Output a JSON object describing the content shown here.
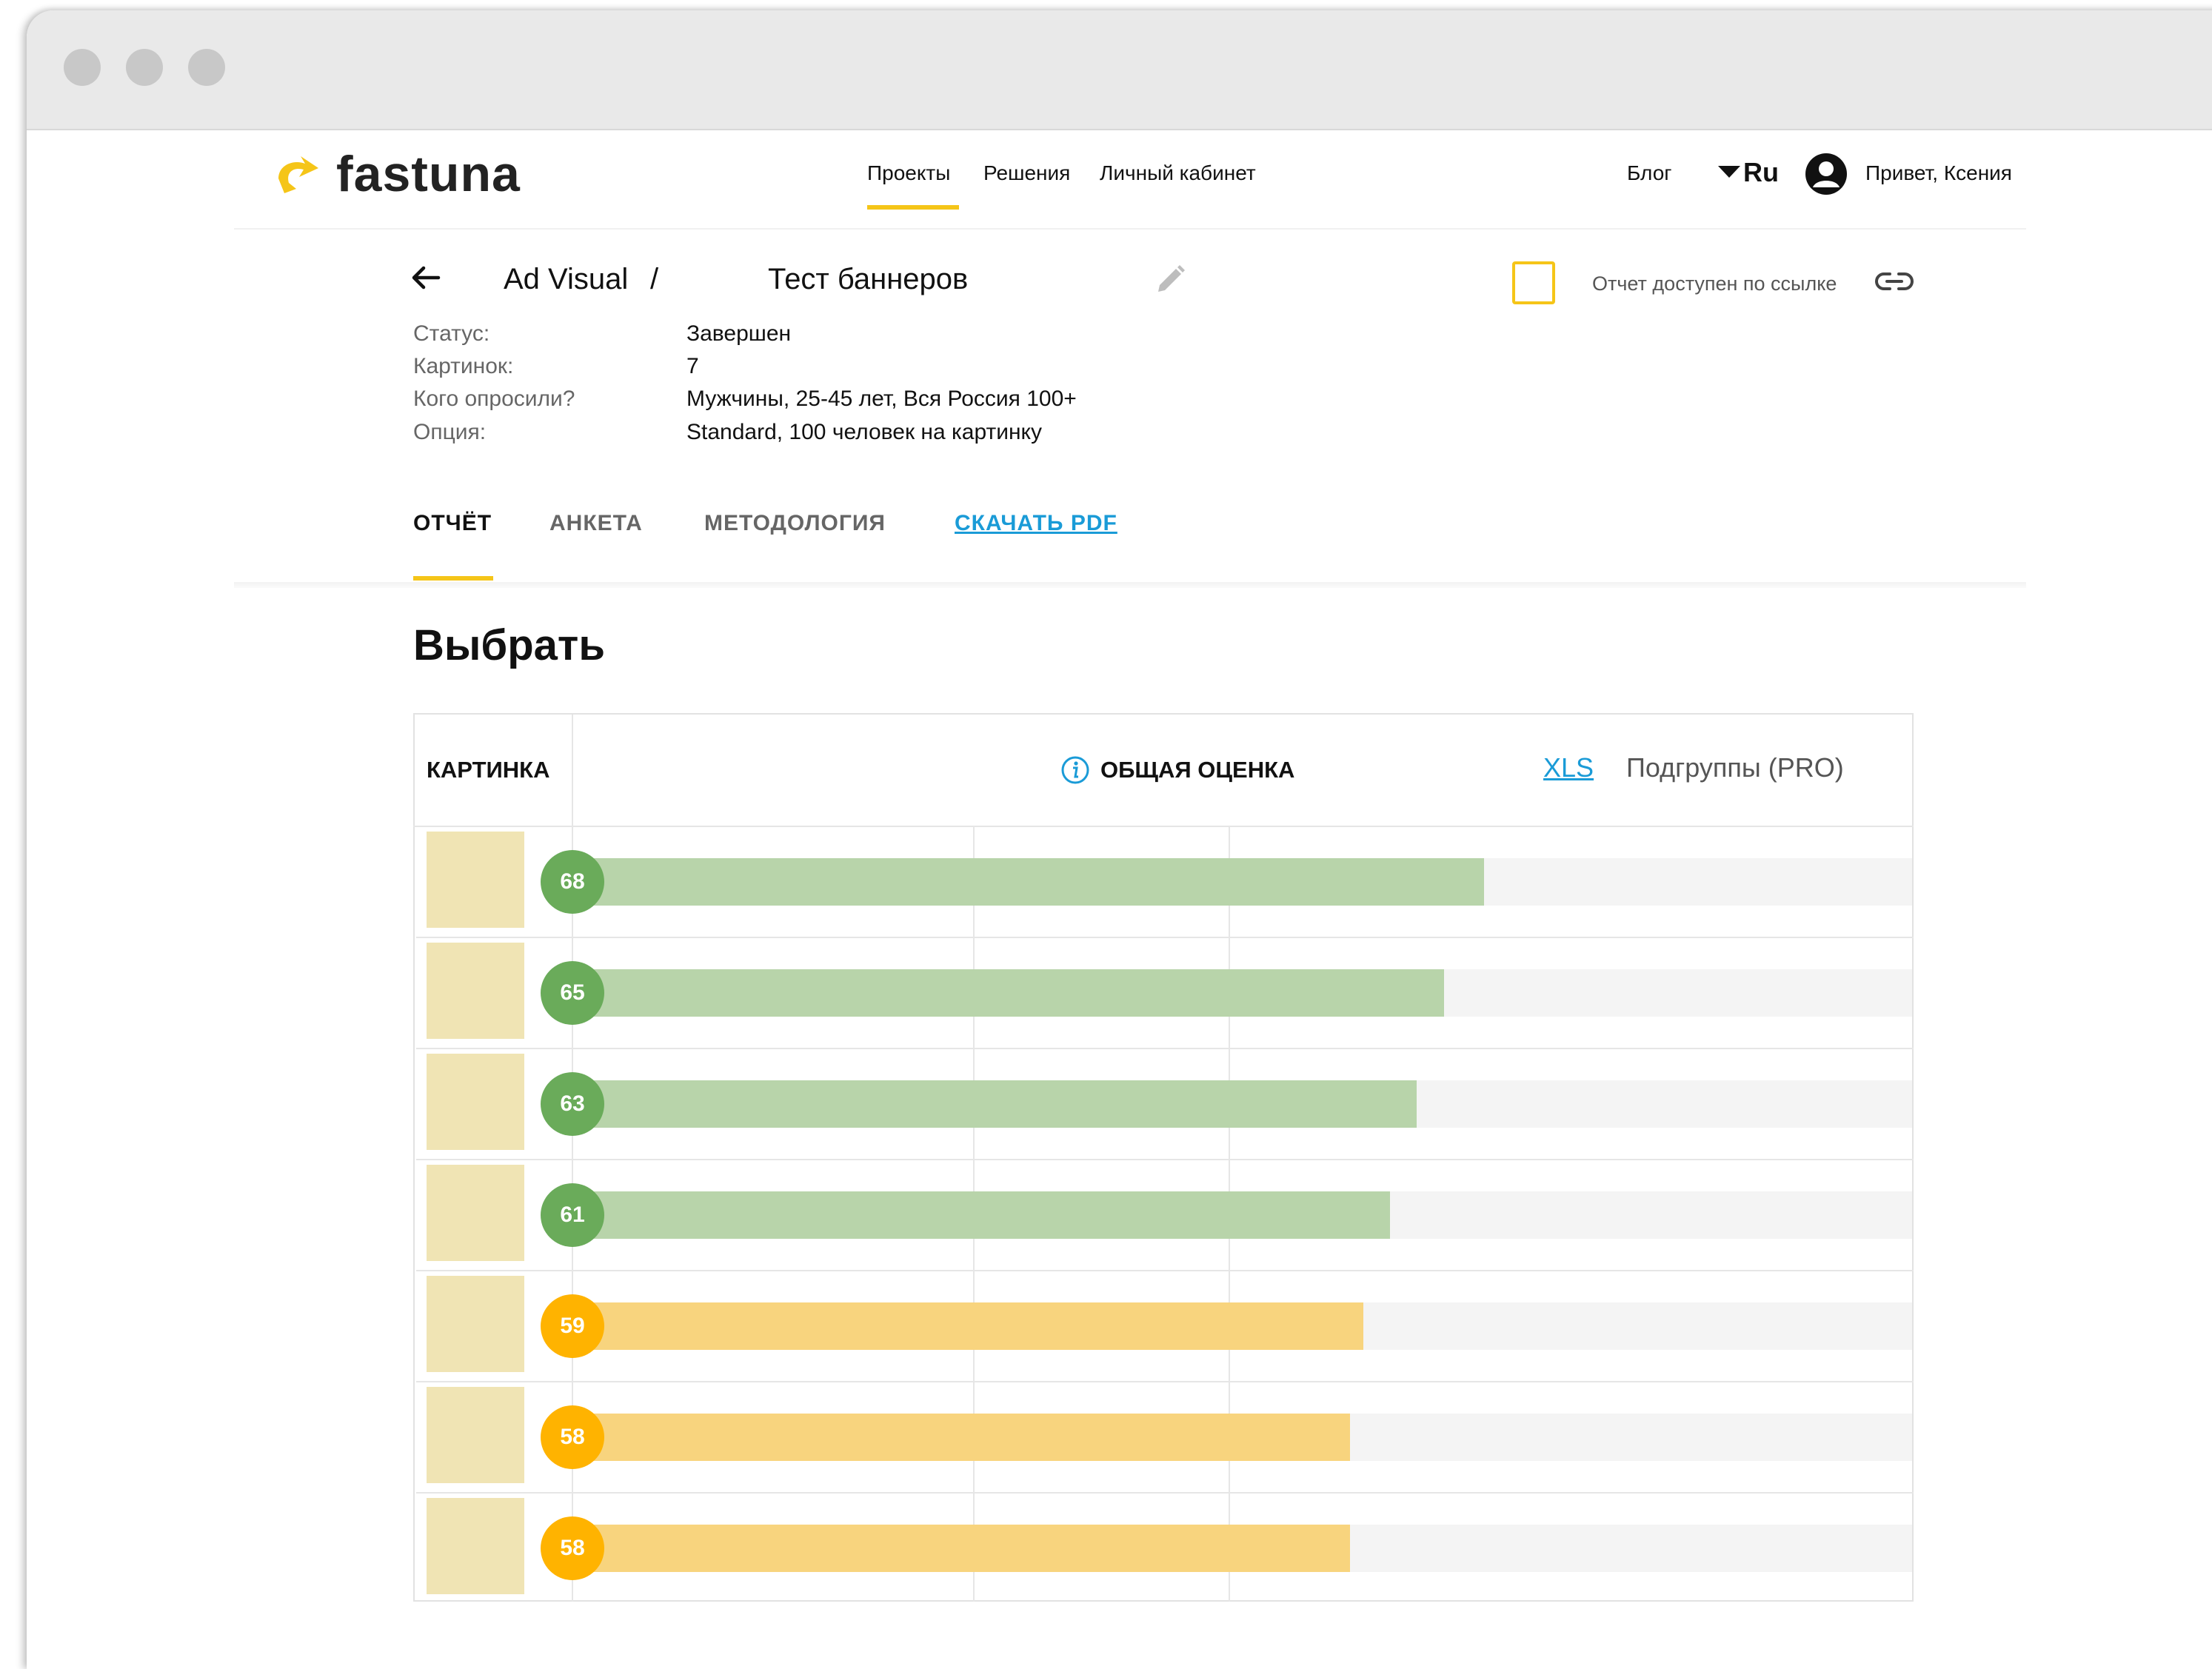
{
  "brand": {
    "name": "fastuna",
    "accent": "#f5c518"
  },
  "nav": {
    "links": [
      "Проекты",
      "Решения",
      "Личный кабинет"
    ],
    "blog": "Блог",
    "language": "Ru",
    "greeting": "Привет, Ксения"
  },
  "project": {
    "breadcrumb": "Ad Visual",
    "separator": "/",
    "name": "Тест баннеров",
    "share_text": "Отчет доступен по ссылке",
    "meta": [
      {
        "label": "Статус:",
        "value": "Завершен"
      },
      {
        "label": "Картинок:",
        "value": "7"
      },
      {
        "label": "Кого опросили?",
        "value": "Мужчины, 25-45 лет, Вся Россия 100+"
      },
      {
        "label": "Опция:",
        "value": "Standard, 100 человек на картинку"
      }
    ]
  },
  "tabs": [
    "ОТЧЁТ",
    "АНКЕТА",
    "МЕТОДОЛОГИЯ",
    "СКАЧАТЬ PDF"
  ],
  "section_title": "Выбрать",
  "table": {
    "col_image": "КАРТИНКА",
    "col_score": "ОБЩАЯ ОЦЕНКА",
    "xls": "XLS",
    "subgroups": "Подгруппы (PRO)"
  },
  "colors": {
    "green_badge": "#6aab5a",
    "green_bar": "#b8d4aa",
    "yellow_badge": "#ffb300",
    "yellow_bar": "#f8d47e"
  },
  "scores": [
    68,
    65,
    63,
    61,
    59,
    58,
    58
  ]
}
